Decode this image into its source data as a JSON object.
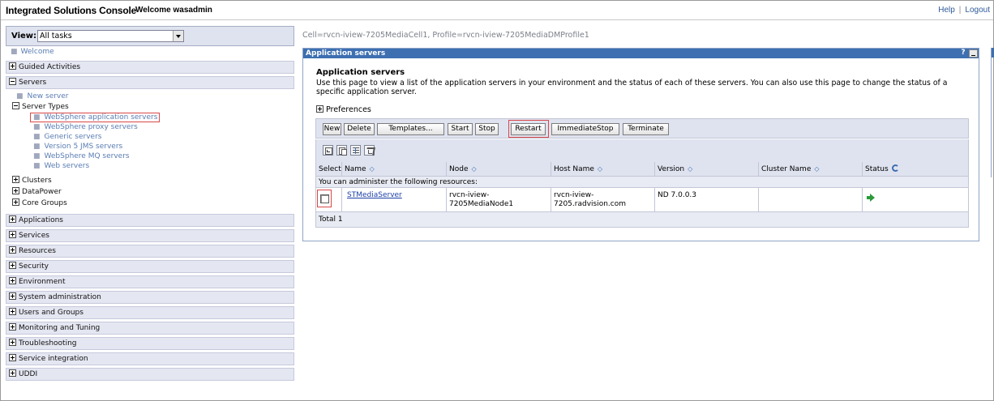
{
  "header": {
    "app_title": "Integrated Solutions Console",
    "welcome": "Welcome wasadmin",
    "help": "Help",
    "separator": "|",
    "logout": "Logout"
  },
  "nav": {
    "view_label": "View:",
    "view_value": "All tasks",
    "welcome": "Welcome",
    "guided_activities": "Guided Activities",
    "servers": "Servers",
    "new_server": "New server",
    "server_types": "Server Types",
    "server_type_items": [
      "WebSphere application servers",
      "WebSphere proxy servers",
      "Generic servers",
      "Version 5 JMS servers",
      "WebSphere MQ servers",
      "Web servers"
    ],
    "clusters": "Clusters",
    "datapower": "DataPower",
    "core_groups": "Core Groups",
    "categories": [
      "Applications",
      "Services",
      "Resources",
      "Security",
      "Environment",
      "System administration",
      "Users and Groups",
      "Monitoring and Tuning",
      "Troubleshooting",
      "Service integration",
      "UDDI"
    ]
  },
  "main": {
    "breadcrumb": "Cell=rvcn-iview-7205MediaCell1, Profile=rvcn-iview-7205MediaDMProfile1",
    "panel_header": "Application servers",
    "help_icon": "?",
    "title": "Application servers",
    "description": "Use this page to view a list of the application servers in your environment and the status of each of these servers. You can also use this page to change the status of a specific application server.",
    "preferences": "Preferences",
    "buttons": {
      "new": "New",
      "delete": "Delete",
      "templates": "Templates...",
      "start": "Start",
      "stop": "Stop",
      "restart": "Restart",
      "immediate_stop": "ImmediateStop",
      "terminate": "Terminate"
    },
    "toolbar_icons": [
      "select-all-icon",
      "deselect-all-icon",
      "filter-icon",
      "clear-filter-icon"
    ],
    "table": {
      "headers": {
        "select": "Select",
        "name": "Name",
        "node": "Node",
        "host": "Host Name",
        "version": "Version",
        "cluster": "Cluster Name",
        "status": "Status"
      },
      "admin_note": "You can administer the following resources:",
      "row": {
        "name": "STMediaServer",
        "node_line1": "rvcn-iview-",
        "node_line2": "7205MediaNode1",
        "host_line1": "rvcn-iview-",
        "host_line2": "7205.radvision.com",
        "version": "ND 7.0.0.3",
        "cluster": "",
        "status_icon": "started-arrow-icon"
      },
      "total": "Total 1"
    }
  },
  "colors": {
    "panel_header": "#3d6fb1",
    "link": "#1b3fa8",
    "highlight": "#d94848",
    "nav_bg": "#e4e6f1"
  }
}
